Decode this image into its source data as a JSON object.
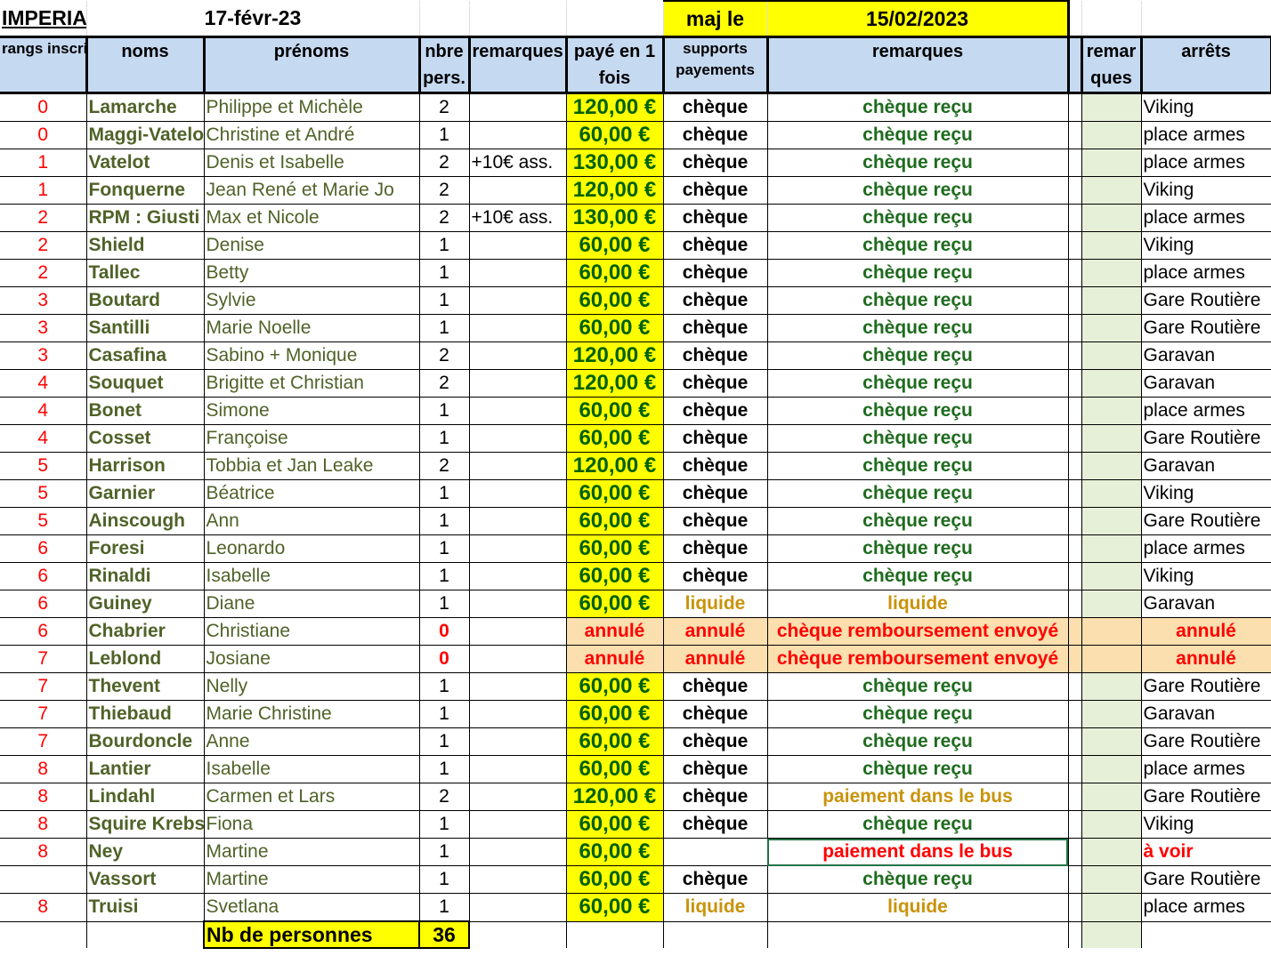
{
  "top": {
    "title": "IMPERIA",
    "date": "17-févr-23",
    "maj_label": "maj le",
    "maj_date": "15/02/2023"
  },
  "headers": {
    "rangs": "rangs inscriptions",
    "noms": "noms",
    "prenoms": "prénoms",
    "nbre": "nbre pers.",
    "remarques": "remarques",
    "paye": "payé en 1 fois",
    "supports": "supports payements",
    "remarques2": "remarques",
    "remarques3": "remar ques",
    "arrets": "arrêts"
  },
  "rows": [
    {
      "rang": "0",
      "nom": "Lamarche",
      "prenom": "Philippe et Michèle",
      "nbre": "2",
      "rem": "",
      "paye": "120,00 €",
      "support": "chèque",
      "remarque": "chèque reçu",
      "arret": "Viking"
    },
    {
      "rang": "0",
      "nom": "Maggi-Vatelot",
      "prenom": "Christine et André",
      "nbre": "1",
      "rem": "",
      "paye": "60,00 €",
      "support": "chèque",
      "remarque": "chèque reçu",
      "arret": "place armes"
    },
    {
      "rang": "1",
      "nom": "Vatelot",
      "prenom": "Denis et Isabelle",
      "nbre": "2",
      "rem": "+10€ ass.",
      "paye": "130,00 €",
      "support": "chèque",
      "remarque": "chèque reçu",
      "arret": "place armes"
    },
    {
      "rang": "1",
      "nom": "Fonquerne",
      "prenom": "Jean René et Marie Jo",
      "nbre": "2",
      "rem": "",
      "paye": "120,00 €",
      "support": "chèque",
      "remarque": "chèque reçu",
      "arret": "Viking"
    },
    {
      "rang": "2",
      "nom": "RPM : Giusti",
      "prenom": "Max et Nicole",
      "nbre": "2",
      "rem": "+10€ ass.",
      "paye": "130,00 €",
      "support": "chèque",
      "remarque": "chèque reçu",
      "arret": "place armes"
    },
    {
      "rang": "2",
      "nom": "Shield",
      "prenom": "Denise",
      "nbre": "1",
      "rem": "",
      "paye": "60,00 €",
      "support": "chèque",
      "remarque": "chèque reçu",
      "arret": "Viking"
    },
    {
      "rang": "2",
      "nom": "Tallec",
      "prenom": "Betty",
      "nbre": "1",
      "rem": "",
      "paye": "60,00 €",
      "support": "chèque",
      "remarque": "chèque reçu",
      "arret": "place armes"
    },
    {
      "rang": "3",
      "nom": "Boutard",
      "prenom": "Sylvie",
      "nbre": "1",
      "rem": "",
      "paye": "60,00 €",
      "support": "chèque",
      "remarque": "chèque reçu",
      "arret": "Gare Routière"
    },
    {
      "rang": "3",
      "nom": "Santilli",
      "prenom": "Marie Noelle",
      "nbre": "1",
      "rem": "",
      "paye": "60,00 €",
      "support": "chèque",
      "remarque": "chèque reçu",
      "arret": "Gare Routière"
    },
    {
      "rang": "3",
      "nom": "Casafina",
      "prenom": "Sabino + Monique",
      "nbre": "2",
      "rem": "",
      "paye": "120,00 €",
      "support": "chèque",
      "remarque": "chèque reçu",
      "arret": "Garavan"
    },
    {
      "rang": "4",
      "nom": "Souquet",
      "prenom": "Brigitte et Christian",
      "nbre": "2",
      "rem": "",
      "paye": "120,00 €",
      "support": "chèque",
      "remarque": "chèque reçu",
      "arret": "Garavan"
    },
    {
      "rang": "4",
      "nom": "Bonet",
      "prenom": "Simone",
      "nbre": "1",
      "rem": "",
      "paye": "60,00 €",
      "support": "chèque",
      "remarque": "chèque reçu",
      "arret": "place armes"
    },
    {
      "rang": "4",
      "nom": "Cosset",
      "prenom": "Françoise",
      "nbre": "1",
      "rem": "",
      "paye": "60,00 €",
      "support": "chèque",
      "remarque": "chèque reçu",
      "arret": "Gare Routière"
    },
    {
      "rang": "5",
      "nom": "Harrison",
      "prenom": "Tobbia et Jan Leake",
      "nbre": "2",
      "rem": "",
      "paye": "120,00 €",
      "support": "chèque",
      "remarque": "chèque reçu",
      "arret": "Garavan"
    },
    {
      "rang": "5",
      "nom": "Garnier",
      "prenom": "Béatrice",
      "nbre": "1",
      "rem": "",
      "paye": "60,00 €",
      "support": "chèque",
      "remarque": "chèque reçu",
      "arret": "Viking"
    },
    {
      "rang": "5",
      "nom": "Ainscough",
      "prenom": "Ann",
      "nbre": "1",
      "rem": "",
      "paye": "60,00 €",
      "support": "chèque",
      "remarque": "chèque reçu",
      "arret": "Gare Routière"
    },
    {
      "rang": "6",
      "nom": "Foresi",
      "prenom": "Leonardo",
      "nbre": "1",
      "rem": "",
      "paye": "60,00 €",
      "support": "chèque",
      "remarque": "chèque reçu",
      "arret": "place armes"
    },
    {
      "rang": "6",
      "nom": "Rinaldi",
      "prenom": "Isabelle",
      "nbre": "1",
      "rem": "",
      "paye": "60,00 €",
      "support": "chèque",
      "remarque": "chèque reçu",
      "arret": "Viking"
    },
    {
      "rang": "6",
      "nom": "Guiney",
      "prenom": "Diane",
      "nbre": "1",
      "rem": "",
      "paye": "60,00 €",
      "support": "liquide",
      "remarque": "liquide",
      "arret": "Garavan",
      "style": "liquide"
    },
    {
      "rang": "6",
      "nom": "Chabrier",
      "prenom": "Christiane",
      "nbre": "0",
      "rem": "",
      "paye": "annulé",
      "support": "annulé",
      "remarque": "chèque remboursement envoyé",
      "arret": "annulé",
      "style": "annule"
    },
    {
      "rang": "7",
      "nom": "Leblond",
      "prenom": "Josiane",
      "nbre": "0",
      "rem": "",
      "paye": "annulé",
      "support": "annulé",
      "remarque": "chèque remboursement envoyé",
      "arret": "annulé",
      "style": "annule"
    },
    {
      "rang": "7",
      "nom": "Thevent",
      "prenom": "Nelly",
      "nbre": "1",
      "rem": "",
      "paye": "60,00 €",
      "support": "chèque",
      "remarque": "chèque reçu",
      "arret": "Gare Routière"
    },
    {
      "rang": "7",
      "nom": "Thiebaud",
      "prenom": "Marie Christine",
      "nbre": "1",
      "rem": "",
      "paye": "60,00 €",
      "support": "chèque",
      "remarque": "chèque reçu",
      "arret": "Garavan"
    },
    {
      "rang": "7",
      "nom": "Bourdoncle",
      "prenom": "Anne",
      "nbre": "1",
      "rem": "",
      "paye": "60,00 €",
      "support": "chèque",
      "remarque": "chèque reçu",
      "arret": "Gare Routière"
    },
    {
      "rang": "8",
      "nom": "Lantier",
      "prenom": "Isabelle",
      "nbre": "1",
      "rem": "",
      "paye": "60,00 €",
      "support": "chèque",
      "remarque": "chèque reçu",
      "arret": "place armes"
    },
    {
      "rang": "8",
      "nom": "Lindahl",
      "prenom": "Carmen et Lars",
      "nbre": "2",
      "rem": "",
      "paye": "120,00 €",
      "support": "chèque",
      "remarque": "paiement dans le bus",
      "arret": "Gare Routière",
      "style": "bus"
    },
    {
      "rang": "8",
      "nom": "Squire Krebs",
      "prenom": "Fiona",
      "nbre": "1",
      "rem": "",
      "paye": "60,00 €",
      "support": "chèque",
      "remarque": "chèque reçu",
      "arret": "Viking"
    },
    {
      "rang": "8",
      "nom": "Ney",
      "prenom": "Martine",
      "nbre": "1",
      "rem": "",
      "paye": "60,00 €",
      "support": "",
      "remarque": "paiement dans le bus",
      "arret": "à voir",
      "style": "voir"
    },
    {
      "rang": "",
      "nom": "Vassort",
      "prenom": "Martine",
      "nbre": "1",
      "rem": "",
      "paye": "60,00 €",
      "support": "chèque",
      "remarque": "chèque reçu",
      "arret": "Gare Routière"
    },
    {
      "rang": "8",
      "nom": "Truisi",
      "prenom": "Svetlana",
      "nbre": "1",
      "rem": "",
      "paye": "60,00 €",
      "support": "liquide",
      "remarque": "liquide",
      "arret": "place armes",
      "style": "liquide"
    }
  ],
  "total": {
    "label": "Nb de personnes",
    "value": "36"
  },
  "colors": {
    "header_bg": "#c5d9f1",
    "paid_bg": "#ffff00",
    "cancel_bg": "#fbdfae"
  }
}
